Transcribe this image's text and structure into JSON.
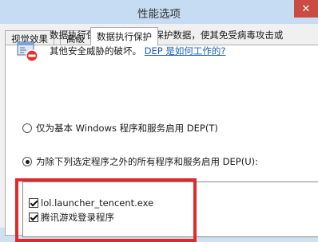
{
  "window": {
    "title": "性能选项",
    "close_glyph": "✕"
  },
  "tabs": [
    {
      "label": "视觉效果"
    },
    {
      "label": "高级"
    },
    {
      "label": "数据执行保护",
      "active": true
    }
  ],
  "panel": {
    "description_line1": "数据执行保护 (DEP) 帮助保护数据，使其免受病毒攻击或",
    "description_line2": "其他安全威胁的破坏。",
    "link_text": "DEP 是如何工作的?",
    "options": [
      {
        "label": "仅为基本 Windows 程序和服务启用 DEP(T)",
        "checked": false
      },
      {
        "label": "为除下列选定程序之外的所有程序和服务启用 DEP(U):",
        "checked": true
      }
    ],
    "programs": [
      {
        "name": "lol.launcher_tencent.exe",
        "checked": true
      },
      {
        "name": "腾讯游戏登录程序",
        "checked": true
      }
    ]
  },
  "colors": {
    "highlight": "#e02a2a",
    "link": "#1a5fb4"
  }
}
